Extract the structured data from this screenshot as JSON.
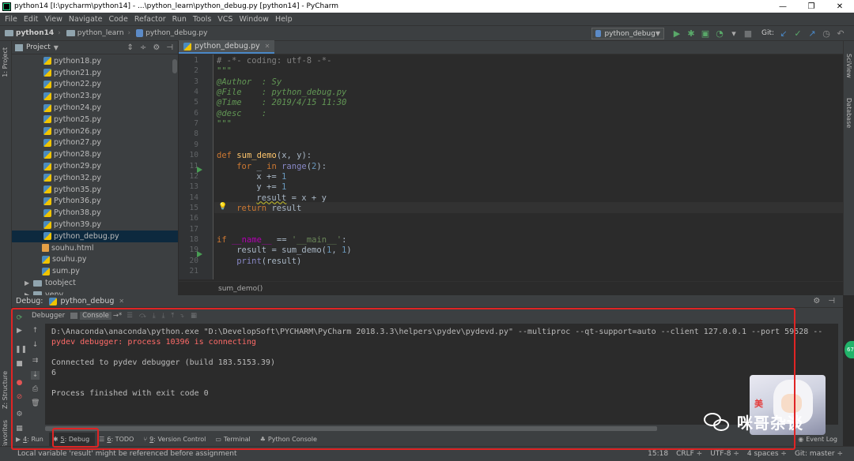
{
  "window": {
    "title": "python14 [I:\\pycharm\\python14] - ...\\python_learn\\python_debug.py [python14] - PyCharm",
    "controls": [
      "—",
      "❐",
      "✕"
    ]
  },
  "menu": [
    "File",
    "Edit",
    "View",
    "Navigate",
    "Code",
    "Refactor",
    "Run",
    "Tools",
    "VCS",
    "Window",
    "Help"
  ],
  "nav": {
    "crumbs": [
      "python14",
      "python_learn",
      "python_debug.py"
    ],
    "run_config": "python_debug",
    "git_label": "Git:"
  },
  "left_stripe": {
    "project_label": "1: Project",
    "structure_label": "Z: Structure",
    "favorites_label": "2: Favorites"
  },
  "right_stripe": {
    "sciview_label": "SciView",
    "database_label": "Database"
  },
  "project": {
    "header": "Project",
    "files": [
      "python18.py",
      "python21.py",
      "python22.py",
      "python23.py",
      "python24.py",
      "python25.py",
      "python26.py",
      "python27.py",
      "python28.py",
      "python29.py",
      "python32.py",
      "python35.py",
      "Python36.py",
      "Python38.py",
      "python39.py",
      "python_debug.py",
      "souhu.html",
      "souhu.py",
      "sum.py"
    ],
    "folders": [
      "toobject",
      "venv"
    ]
  },
  "editor": {
    "tab": "python_debug.py",
    "line_numbers": [
      "1",
      "2",
      "3",
      "4",
      "5",
      "6",
      "7",
      "8",
      "9",
      "10",
      "11",
      "12",
      "13",
      "14",
      "15",
      "16",
      "17",
      "18",
      "19",
      "20",
      "21"
    ],
    "lines": {
      "l1": "# -*- coding: utf-8 -*-",
      "l2": "\"\"\"",
      "l3": "@Author  : Sy",
      "l4": "@File    : python_debug.py",
      "l5": "@Time    : 2019/4/15 11:30",
      "l6": "@desc    :",
      "l7": "\"\"\"",
      "l10_kw": "def ",
      "l10_fn": "sum_demo",
      "l10_rest": "(x, y):",
      "l11_kw": "for ",
      "l11_mid": "_ ",
      "l11_kw2": "in ",
      "l11_bi": "range",
      "l11_p1": "(",
      "l11_num": "2",
      "l11_p2": "):",
      "l12_a": "x += ",
      "l12_num": "1",
      "l13_a": "y += ",
      "l13_num": "1",
      "l14_a": "result",
      "l14_b": " = x + y",
      "l15_kw": "return ",
      "l15_b": "result",
      "l18_kw": "if ",
      "l18_a": "__name__",
      "l18_b": " == ",
      "l18_str": "'__main__'",
      "l18_c": ":",
      "l19_a": "result = sum_demo(",
      "l19_n1": "1",
      "l19_b": ", ",
      "l19_n2": "1",
      "l19_c": ")",
      "l20_bi": "print",
      "l20_a": "(result)"
    },
    "breadcrumb": "sum_demo()"
  },
  "debug": {
    "label": "Debug:",
    "session": "python_debug",
    "subtabs": [
      "Debugger",
      "Console"
    ],
    "console_lines": [
      "D:\\Anaconda\\anaconda\\python.exe \"D:\\DevelopSoft\\PYCHARM\\PyCharm 2018.3.3\\helpers\\pydev\\pydevd.py\" --multiproc --qt-support=auto --client 127.0.0.1 --port 59528 --",
      "pydev debugger: process 10396 is connecting",
      "",
      "Connected to pydev debugger (build 183.5153.39)",
      "6",
      "",
      "Process finished with exit code 0"
    ]
  },
  "bottom_tools": [
    {
      "key": "4",
      "label": ": Run"
    },
    {
      "key": "5",
      "label": ": Debug"
    },
    {
      "key": "6",
      "label": ": TODO"
    },
    {
      "key": "9",
      "label": ": Version Control"
    },
    {
      "key": "",
      "label": "Terminal"
    },
    {
      "key": "",
      "label": "Python Console"
    }
  ],
  "event_log": "Event Log",
  "status": {
    "message": "Local variable 'result' might be referenced before assignment",
    "position": "15:18",
    "line_sep": "CRLF ÷",
    "encoding": "UTF-8 ÷",
    "indent": "4 spaces ÷",
    "git": "Git: master ÷"
  },
  "watermark": {
    "text": "咪哥杂谈",
    "avatar_text": "美"
  },
  "badge": "67",
  "colors": {
    "accent": "#4a88c7",
    "highlight_red": "#e02424",
    "run_green": "#499c54",
    "error_red": "#ff6b68"
  }
}
